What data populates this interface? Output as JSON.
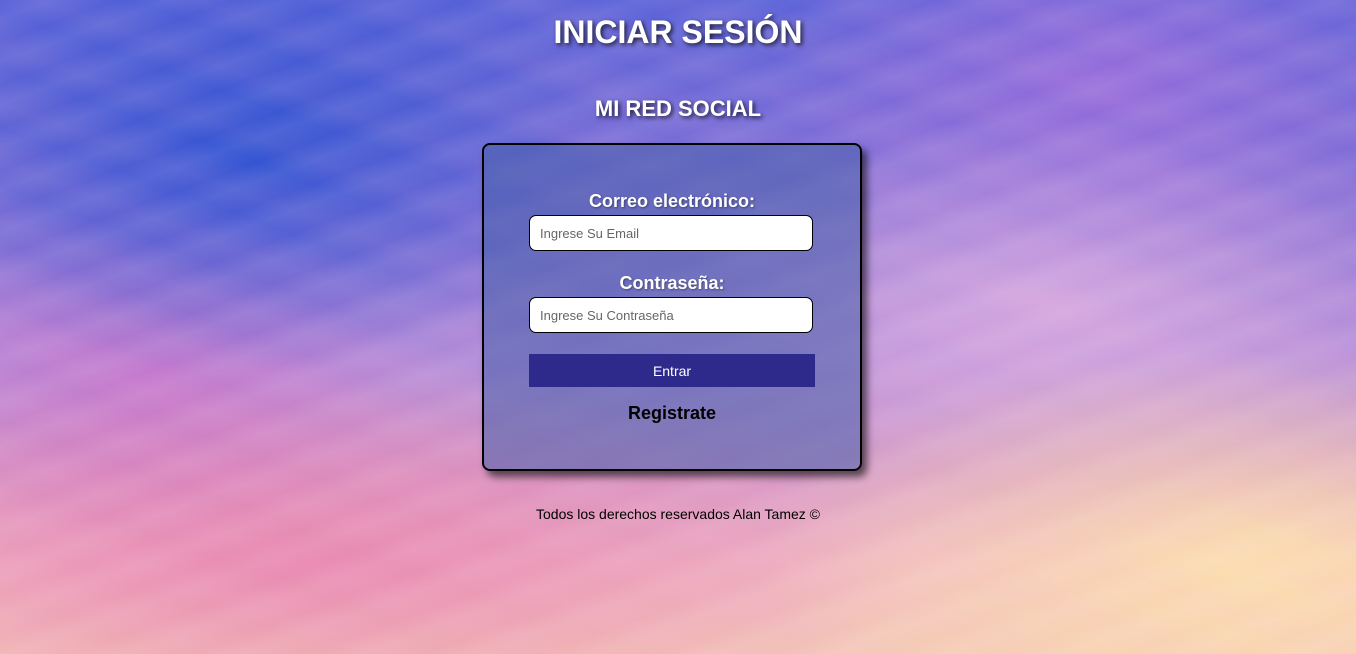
{
  "header": {
    "title": "INICIAR SESIÓN",
    "brand": "MI RED SOCIAL"
  },
  "login_form": {
    "email_label": "Correo electrónico:",
    "email_placeholder": "Ingrese Su Email",
    "email_value": "",
    "password_label": "Contraseña:",
    "password_placeholder": "Ingrese Su Contraseña",
    "password_value": "",
    "submit_label": "Entrar",
    "register_label": "Registrate"
  },
  "footer": {
    "text": "Todos los derechos reservados Alan Tamez ©"
  },
  "colors": {
    "button_background": "#2e2a8c",
    "text_primary": "#ffffff",
    "card_background": "rgba(70, 95, 170, 0.55)"
  }
}
